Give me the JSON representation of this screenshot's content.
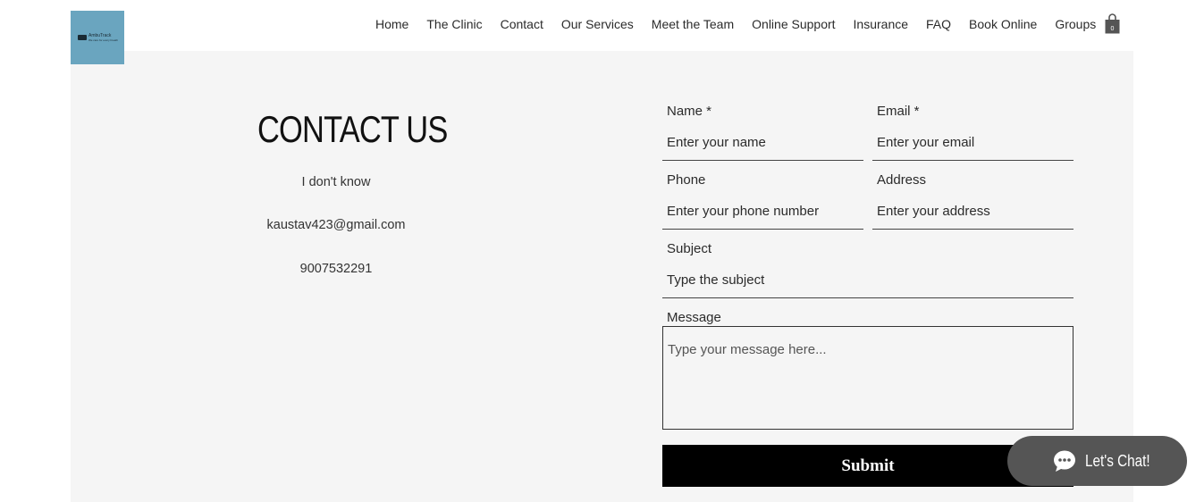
{
  "header": {
    "logo": {
      "name": "AmbuTrack",
      "tagline": "We care for every breath"
    },
    "nav": [
      "Home",
      "The Clinic",
      "Contact",
      "Our Services",
      "Meet the Team",
      "Online Support",
      "Insurance",
      "FAQ",
      "Book Online",
      "Groups"
    ],
    "cart_count": "0"
  },
  "contact": {
    "title": "CONTACT US",
    "line1": "I don't know",
    "email": "kaustav423@gmail.com",
    "phone": "9007532291"
  },
  "form": {
    "name_label": "Name *",
    "name_placeholder": "Enter your name",
    "email_label": "Email *",
    "email_placeholder": "Enter your email",
    "phone_label": "Phone",
    "phone_placeholder": "Enter your phone number",
    "address_label": "Address",
    "address_placeholder": "Enter your address",
    "subject_label": "Subject",
    "subject_placeholder": "Type the subject",
    "message_label": "Message",
    "message_placeholder": "Type your message here...",
    "submit_label": "Submit"
  },
  "chat": {
    "label": "Let's Chat!"
  },
  "colors": {
    "logo_bg": "#6aa5bf",
    "section_bg": "#f5f5f5",
    "submit_bg": "#000000",
    "chat_bg": "#555555"
  }
}
